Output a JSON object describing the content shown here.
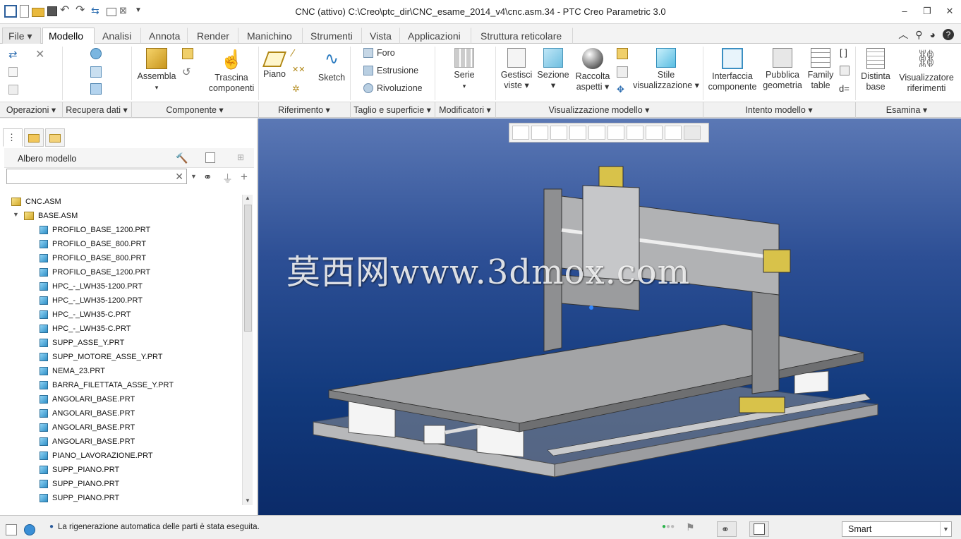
{
  "window": {
    "title": "CNC (attivo) C:\\Creo\\ptc_dir\\CNC_esame_2014_v4\\cnc.asm.34 - PTC Creo Parametric 3.0",
    "controls": [
      "–",
      "❐",
      "✕"
    ]
  },
  "tabs": [
    {
      "label": "File ▾",
      "active": false
    },
    {
      "label": "Modello",
      "active": true
    },
    {
      "label": "Analisi",
      "active": false
    },
    {
      "label": "Annota",
      "active": false
    },
    {
      "label": "Render",
      "active": false
    },
    {
      "label": "Manichino",
      "active": false
    },
    {
      "label": "Strumenti",
      "active": false
    },
    {
      "label": "Vista",
      "active": false
    },
    {
      "label": "Applicazioni",
      "active": false
    },
    {
      "label": "Struttura reticolare",
      "active": false
    }
  ],
  "ribbon": {
    "assembla": "Assembla",
    "trascina_1": "Trascina",
    "trascina_2": "componenti",
    "piano": "Piano",
    "sketch": "Sketch",
    "foro": "Foro",
    "estrusione": "Estrusione",
    "rivoluzione": "Rivoluzione",
    "serie": "Serie",
    "gestisci_1": "Gestisci",
    "gestisci_2": "viste ▾",
    "sezione_1": "Sezione",
    "sezione_2": "▾",
    "raccolta_1": "Raccolta",
    "raccolta_2": "aspetti ▾",
    "stile_1": "Stile",
    "stile_2": "visualizzazione ▾",
    "interfaccia_1": "Interfaccia",
    "interfaccia_2": "componente",
    "pubblica_1": "Pubblica",
    "pubblica_2": "geometria",
    "family_1": "Family",
    "family_2": "table",
    "distinta_1": "Distinta",
    "distinta_2": "base",
    "visual_1": "Visualizzatore",
    "visual_2": "riferimenti",
    "d_equals": "d="
  },
  "groups": [
    "Operazioni ▾",
    "Recupera dati ▾",
    "Componente ▾",
    "Riferimento ▾",
    "Taglio e superficie ▾",
    "Modificatori ▾",
    "Visualizzazione modello ▾",
    "Intento modello ▾",
    "Esamina ▾"
  ],
  "tree": {
    "header": "Albero modello",
    "search_value": "",
    "root": "CNC.ASM",
    "sub": "BASE.ASM",
    "items": [
      "PROFILO_BASE_1200.PRT",
      "PROFILO_BASE_800.PRT",
      "PROFILO_BASE_800.PRT",
      "PROFILO_BASE_1200.PRT",
      "HPC_-_LWH35-1200.PRT",
      "HPC_-_LWH35-1200.PRT",
      "HPC_-_LWH35-C.PRT",
      "HPC_-_LWH35-C.PRT",
      "SUPP_ASSE_Y.PRT",
      "SUPP_MOTORE_ASSE_Y.PRT",
      "NEMA_23.PRT",
      "BARRA_FILETTATA_ASSE_Y.PRT",
      "ANGOLARI_BASE.PRT",
      "ANGOLARI_BASE.PRT",
      "ANGOLARI_BASE.PRT",
      "ANGOLARI_BASE.PRT",
      "PIANO_LAVORAZIONE.PRT",
      "SUPP_PIANO.PRT",
      "SUPP_PIANO.PRT",
      "SUPP_PIANO.PRT"
    ]
  },
  "viewport": {
    "watermark": "莫西网www.3dmox.com"
  },
  "status": {
    "message": "La rigenerazione automatica delle parti è stata eseguita.",
    "filter": "Smart"
  },
  "colors": {
    "accent": "#2a6f9a",
    "viewport_top": "#5b78b5",
    "viewport_bottom": "#0b2b69"
  }
}
